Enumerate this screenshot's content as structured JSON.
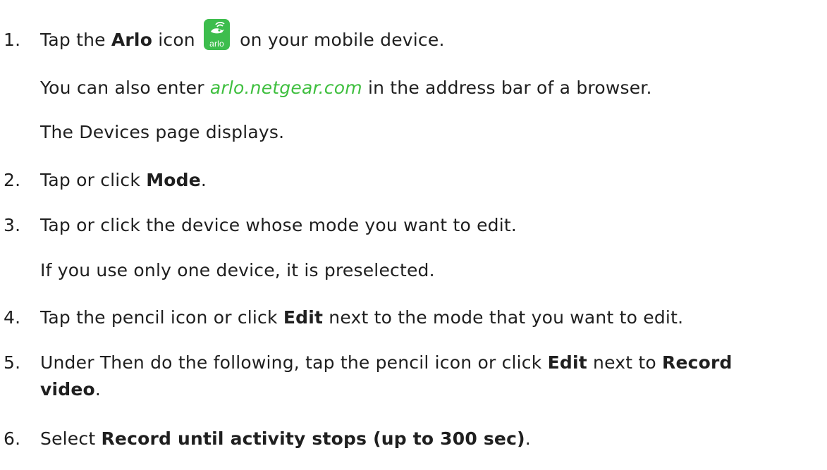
{
  "steps": [
    {
      "num": "1.",
      "pre": "Tap the ",
      "bold": "Arlo",
      "mid": " icon",
      "post": " on your mobile device.",
      "icon_text": "arlo",
      "icon_color": "#3dbd4d"
    },
    {
      "pre": "You can also enter ",
      "link": "arlo.netgear.com",
      "post": " in the address bar of a browser."
    },
    {
      "text": "The Devices page displays."
    },
    {
      "num": "2.",
      "pre": "Tap or click ",
      "bold": "Mode",
      "post": "."
    },
    {
      "num": "3.",
      "text": "Tap or click the device whose mode you want to edit."
    },
    {
      "text": "If you use only one device, it is preselected."
    },
    {
      "num": "4.",
      "pre": "Tap the pencil icon or click ",
      "bold": "Edit",
      "post": " next to the mode that you want to edit."
    },
    {
      "num": "5.",
      "pre": "Under Then do the following, tap the pencil icon or click ",
      "bold": "Edit",
      "mid": " next to ",
      "bold2": "Record",
      "line2_bold": "video",
      "line2_post": "."
    },
    {
      "num": "6.",
      "pre": "Select ",
      "bold": "Record until activity stops (up to 300 sec)",
      "post": "."
    }
  ],
  "colors": {
    "link": "#3fbf3f",
    "text": "#1f1f1f"
  }
}
